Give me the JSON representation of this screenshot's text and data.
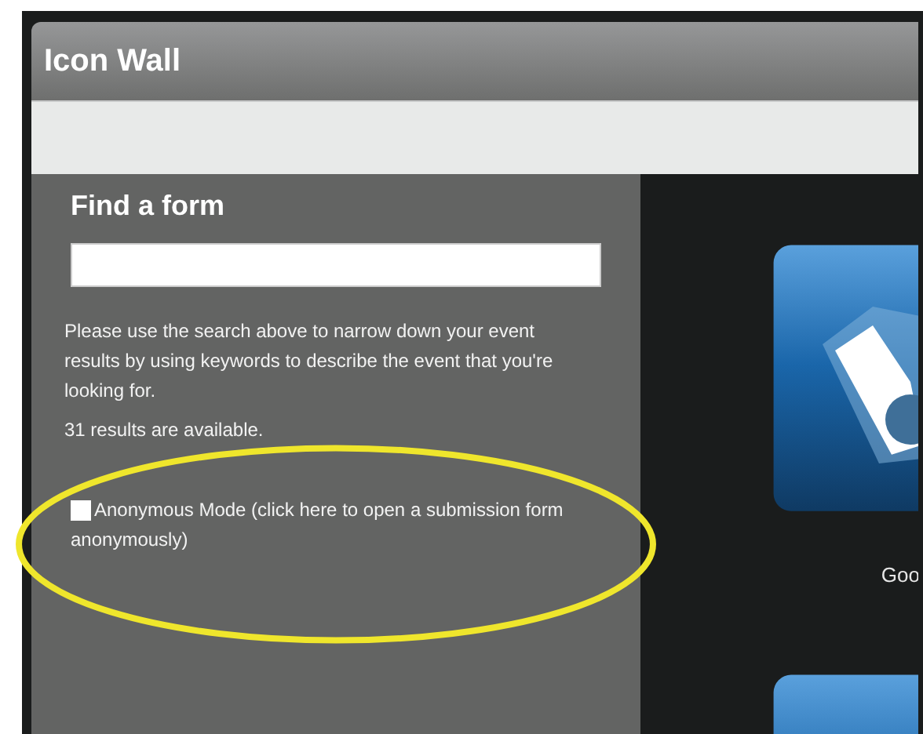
{
  "window": {
    "title": "Icon Wall"
  },
  "search_panel": {
    "heading": "Find a form",
    "help_text": "Please use the search above to narrow down your event results by using keywords to describe the event that you're looking for.",
    "results_count": "31 results are available.",
    "anonymous_mode": {
      "label": "Anonymous Mode (click here to open a submission form anonymously)",
      "checked": false
    }
  },
  "icon_wall": {
    "tiles": [
      {
        "kind": "icon",
        "label": "Goo"
      },
      {
        "kind": "icon"
      }
    ]
  }
}
